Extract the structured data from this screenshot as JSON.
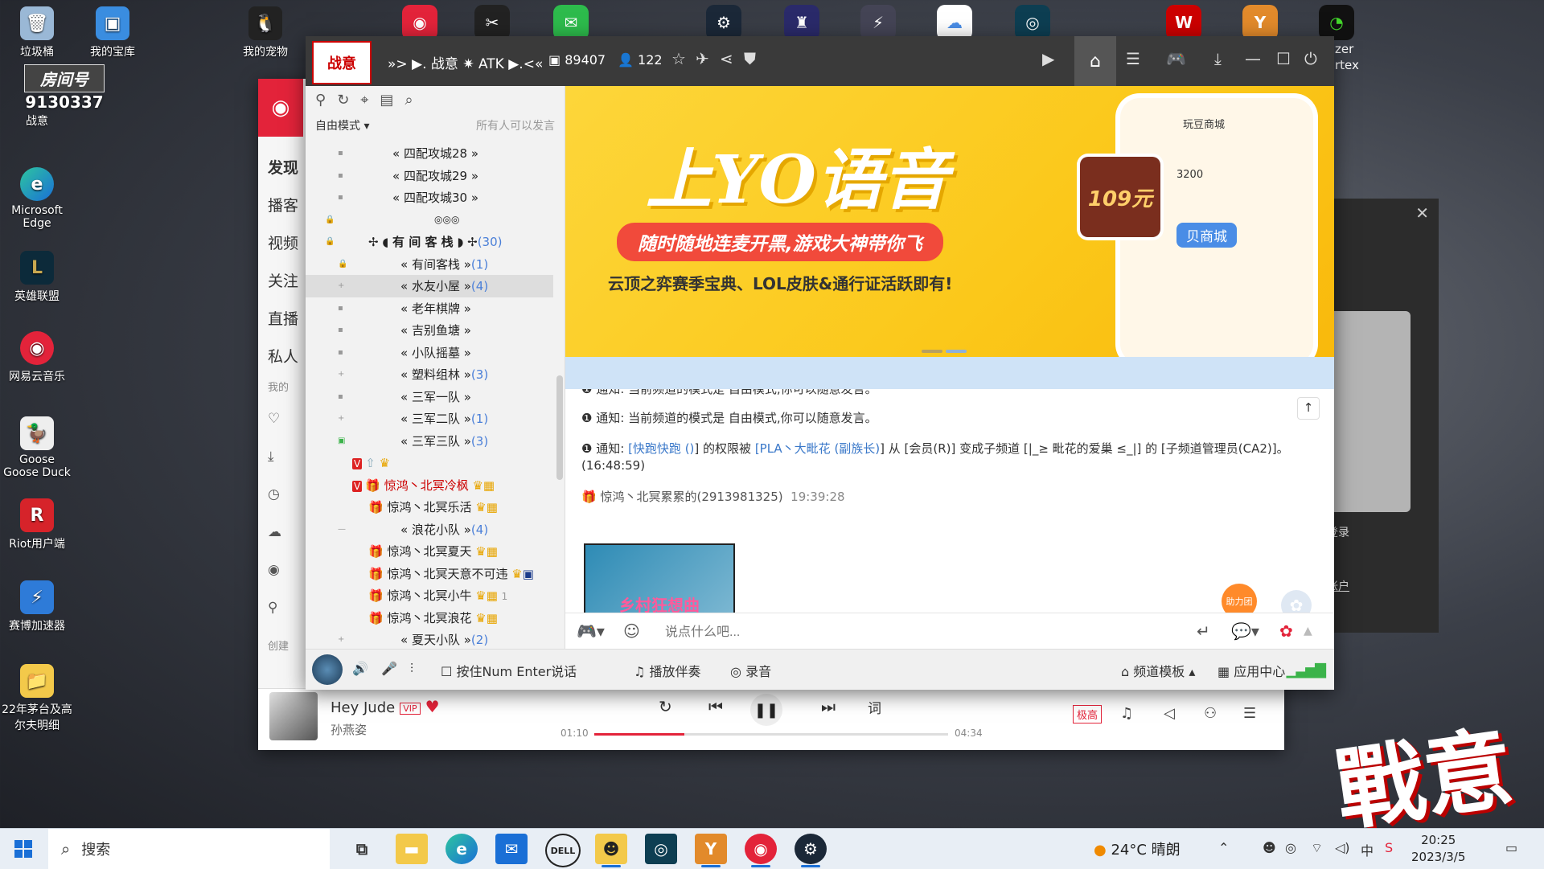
{
  "desktop": {
    "icons": [
      {
        "label": "垃圾桶"
      },
      {
        "label": "我的宝库"
      },
      {
        "label": "我的宠物"
      },
      {
        "label": "战意"
      },
      {
        "label": "Microsoft Edge"
      },
      {
        "label": "英雄联盟"
      },
      {
        "label": "网易云音乐"
      },
      {
        "label": "Goose Goose Duck"
      },
      {
        "label": "Riot用户端"
      },
      {
        "label": "赛博加速器"
      },
      {
        "label": "22年茅台及高尔夫明细"
      }
    ],
    "room_badge": {
      "title": "房间号",
      "number": "9130337"
    },
    "partial_labels": {
      "zer": "zer",
      "rtex": "rtex"
    },
    "brand_text": "戰意"
  },
  "yy": {
    "channel_name": "»> ▶. 战意 ✷ ATK ▶.<«",
    "room_id": "89407",
    "online_count": "122",
    "mode_label": "自由模式",
    "mode_right": "所有人可以发言",
    "channels": [
      {
        "name": "四配攻城28",
        "count": ""
      },
      {
        "name": "四配攻城29",
        "count": ""
      },
      {
        "name": "四配攻城30",
        "count": ""
      },
      {
        "name": "◎◎◎",
        "count": ""
      },
      {
        "name": "有 间 客 栈",
        "count": "(30)"
      },
      {
        "name": "有间客栈",
        "count": "(1)"
      },
      {
        "name": "水友小屋",
        "count": "(4)"
      },
      {
        "name": "老年棋牌",
        "count": ""
      },
      {
        "name": "吉别鱼塘",
        "count": ""
      },
      {
        "name": "小队摇墓",
        "count": ""
      },
      {
        "name": "塑料组林",
        "count": "(3)"
      },
      {
        "name": "三军一队",
        "count": ""
      },
      {
        "name": "三军二队",
        "count": "(1)"
      },
      {
        "name": "三军三队",
        "count": "(3)"
      }
    ],
    "members": [
      {
        "name": "惊鸿丶北冥冷枫"
      },
      {
        "name": "惊鸿丶北冥乐活"
      },
      {
        "name": "浪花小队",
        "count": "(4)"
      },
      {
        "name": "惊鸿丶北冥夏天"
      },
      {
        "name": "惊鸿丶北冥天意不可违"
      },
      {
        "name": "惊鸿丶北冥小牛",
        "extra": "1"
      },
      {
        "name": "惊鸿丶北冥浪花"
      },
      {
        "name": "夏天小队",
        "count": "(2)"
      }
    ],
    "banner": {
      "headline": "上YO语音",
      "pill": "随时随地连麦开黑,游戏大神带你飞",
      "subline": "云顶之弈赛季宝典、LOL皮肤&通行证活跃即有!",
      "phone_title": "玩豆商城",
      "phone_number": "3200",
      "phone_mall": "贝商城",
      "box_text": "109元"
    },
    "chat": {
      "notice_label": "通知:",
      "notice_text": "当前频道的模式是 自由模式,你可以随意发言。",
      "notice2_prefix": "通知:",
      "notice2_user": "[快跑快跑 ()",
      "notice2_mid": "] 的权限被",
      "notice2_admin": "[PLA丶大毗花 (副族长)",
      "notice2_rest": "] 从 [会员(R)] 变成子频道 [|_≥ 毗花的爱巢 ≤_|] 的 [子频道管理员(CA2)]。(16:48:59)",
      "sender": "惊鸿丶北冥累累的(2913981325)",
      "sender_time": "19:39:28",
      "image_caption": "乡村狂想曲",
      "gift_label": "助力团",
      "input_placeholder": "说点什么吧..."
    },
    "bottom": {
      "push_to_talk": "按住Num Enter说话",
      "play_music": "播放伴奏",
      "record": "录音",
      "template": "频道模板",
      "app_center": "应用中心"
    }
  },
  "music": {
    "side": [
      "发现",
      "播客",
      "视频",
      "关注",
      "直播",
      "私人"
    ],
    "side_section": "我的",
    "side_create": "创建",
    "song": "Hey Jude",
    "vip": "VIP",
    "artist": "孙燕姿",
    "time_current": "01:10",
    "time_total": "04:34",
    "progress": 0.255,
    "quality": "极高",
    "lyric_btn": "词",
    "login_text": "手机应用登录",
    "register_text": "创建免费帐户"
  },
  "taskbar": {
    "search": "搜索",
    "weather": "24°C 晴朗",
    "time": "20:25",
    "date": "2023/3/5",
    "ime": "中"
  }
}
